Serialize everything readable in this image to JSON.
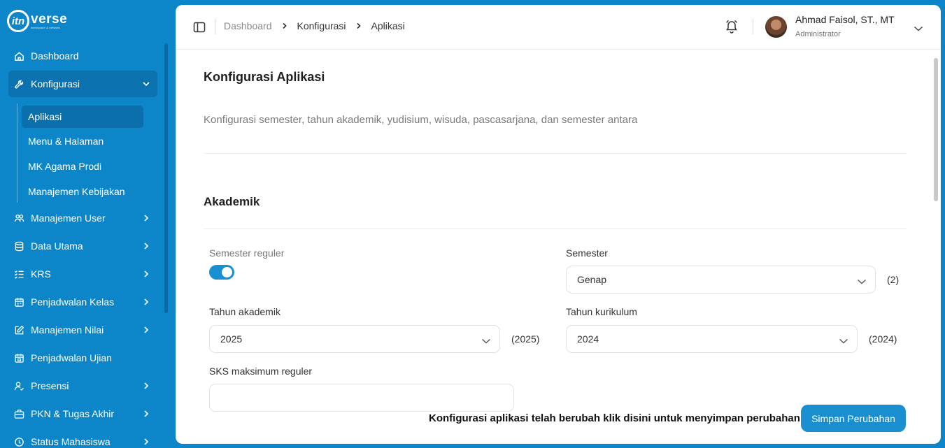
{
  "brand": {
    "logo_mark": "itn",
    "name": "verse",
    "tagline": "workspace & network"
  },
  "sidebar": {
    "items": [
      {
        "label": "Dashboard",
        "icon": "home-icon"
      },
      {
        "label": "Konfigurasi",
        "icon": "wrench-icon",
        "active": true,
        "expanded": true
      },
      {
        "label": "Manajemen User",
        "icon": "users-icon"
      },
      {
        "label": "Data Utama",
        "icon": "database-icon"
      },
      {
        "label": "KRS",
        "icon": "checklist-icon"
      },
      {
        "label": "Penjadwalan Kelas",
        "icon": "calendar-icon"
      },
      {
        "label": "Manajemen Nilai",
        "icon": "edit-icon"
      },
      {
        "label": "Penjadwalan Ujian",
        "icon": "calendar-grid-icon"
      },
      {
        "label": "Presensi",
        "icon": "user-check-icon"
      },
      {
        "label": "PKN & Tugas Akhir",
        "icon": "briefcase-icon"
      },
      {
        "label": "Status Mahasiswa",
        "icon": "status-icon"
      }
    ],
    "submenu": [
      {
        "label": "Aplikasi",
        "active": true
      },
      {
        "label": "Menu & Halaman"
      },
      {
        "label": "MK Agama Prodi"
      },
      {
        "label": "Manajemen Kebijakan"
      }
    ]
  },
  "header": {
    "breadcrumb": [
      "Dashboard",
      "Konfigurasi",
      "Aplikasi"
    ],
    "user_name": "Ahmad Faisol, ST., MT",
    "user_role": "Administrator"
  },
  "page": {
    "title": "Konfigurasi Aplikasi",
    "description": "Konfigurasi semester, tahun akademik, yudisium, wisuda, pascasarjana, dan semester antara",
    "section_title": "Akademik"
  },
  "form": {
    "semester_reguler": {
      "label": "Semester reguler",
      "enabled": true
    },
    "semester": {
      "label": "Semester",
      "value": "Genap",
      "suffix": "(2)"
    },
    "tahun_akademik": {
      "label": "Tahun akademik",
      "value": "2025",
      "suffix": "(2025)"
    },
    "tahun_kurikulum": {
      "label": "Tahun kurikulum",
      "value": "2024",
      "suffix": "(2024)"
    },
    "sks_maksimum": {
      "label": "SKS maksimum reguler"
    }
  },
  "footer": {
    "message": "Konfigurasi aplikasi telah berubah klik disini untuk menyimpan perubahan",
    "save_label": "Simpan Perubahan"
  },
  "colors": {
    "sidebar_bg": "#0d86c9",
    "accent": "#1a8fd0",
    "active_item": "#0b72af"
  }
}
